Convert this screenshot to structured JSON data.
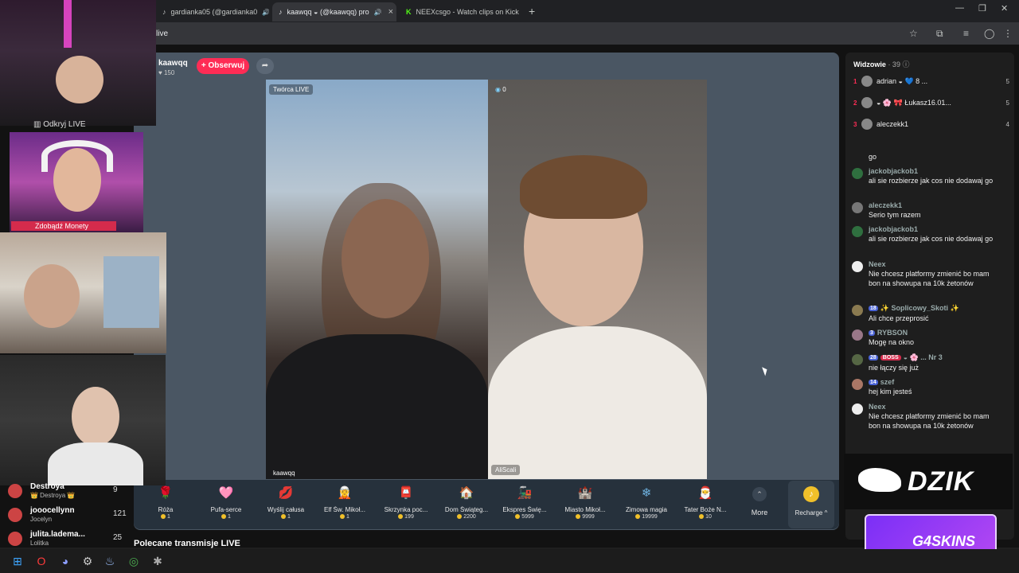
{
  "browser": {
    "tabs": [
      {
        "title": "gardianka05 (@gardianka0",
        "icon": "tiktok-icon"
      },
      {
        "title": "kaawqq ◒ (@kaawqq) pro",
        "icon": "tiktok-icon"
      },
      {
        "title": "NEEXcsgo - Watch clips on Kick",
        "icon": "kick-icon"
      }
    ],
    "url": "live"
  },
  "stream": {
    "host_name": "kaawqq",
    "host_likes": "150",
    "follow_label": "+ Obserwuj",
    "creator_badge": "Twórca LIVE",
    "guest_count": "0",
    "host_video_label": "kaawqq",
    "guest_video_label": "AliScali"
  },
  "gifts": [
    {
      "name": "Róża",
      "price": "1",
      "icon": "rose-icon",
      "color": "#e0314f",
      "glyph": "🌹"
    },
    {
      "name": "Pufa-serce",
      "price": "1",
      "icon": "heart-pouf-icon",
      "color": "#f5a9d2",
      "glyph": "🩷"
    },
    {
      "name": "Wyślij całusa",
      "price": "1",
      "icon": "kiss-icon",
      "color": "#e0314f",
      "glyph": "💋"
    },
    {
      "name": "Elf Św. Mikoł...",
      "price": "1",
      "icon": "elf-icon",
      "color": "#3aa655",
      "glyph": "🧝"
    },
    {
      "name": "Skrzynka poc...",
      "price": "199",
      "icon": "mailbox-icon",
      "color": "#d8453b",
      "glyph": "📮"
    },
    {
      "name": "Dom Świąteg...",
      "price": "2200",
      "icon": "house-icon",
      "color": "#d98b4a",
      "glyph": "🏠"
    },
    {
      "name": "Ekspres Świę...",
      "price": "5999",
      "icon": "train-icon",
      "color": "#3b8f5e",
      "glyph": "🚂"
    },
    {
      "name": "Miasto Mikoł...",
      "price": "9999",
      "icon": "castle-icon",
      "color": "#8a5ec7",
      "glyph": "🏰"
    },
    {
      "name": "Zimowa magia",
      "price": "19999",
      "icon": "winter-magic-icon",
      "color": "#6fb2e0",
      "glyph": "❄"
    },
    {
      "name": "Tater Boże N...",
      "price": "10",
      "icon": "potato-santa-icon",
      "color": "#c28a3d",
      "glyph": "🎅"
    }
  ],
  "gifts_more_label": "More",
  "recharge_label": "Recharge ^",
  "suggested_label": "Polecane transmisje LIVE",
  "chat": {
    "viewers_label": "Widzowie",
    "viewers_count": "· 39",
    "top_viewers": [
      {
        "rank": "1",
        "name": "adrian ◒ 💙 8 ...",
        "score": "5"
      },
      {
        "rank": "2",
        "name": "◒ 🌸 🎀 Łukasz16.01...",
        "score": "5"
      },
      {
        "rank": "3",
        "name": "aleczekk1",
        "score": "4"
      }
    ],
    "messages": [
      {
        "user": "",
        "text": "go",
        "lvl": "",
        "boss": ""
      },
      {
        "user": "jackobjackob1",
        "text": "ali sie rozbierze jak cos nie dodawaj go",
        "lvl": "",
        "boss": ""
      },
      {
        "user": "aleczekk1",
        "text": "Serio tym razem",
        "lvl": "",
        "boss": ""
      },
      {
        "user": "jackobjackob1",
        "text": "ali sie rozbierze jak cos nie dodawaj go",
        "lvl": "",
        "boss": ""
      },
      {
        "user": "Neex",
        "text": "Nie chcesz platformy zmienić bo mam bon na showupa na 10k żetonów",
        "lvl": "",
        "boss": ""
      },
      {
        "user": "✨ Soplicowy_Skoti ✨",
        "text": "Ali chce przeprosić",
        "lvl": "18",
        "boss": ""
      },
      {
        "user": "RYBSON",
        "text": "Mogę na okno",
        "lvl": "3",
        "boss": ""
      },
      {
        "user": "◒ 🌸 ... Nr 3",
        "text": "nie łączy się już",
        "lvl": "28",
        "boss": "BOSS"
      },
      {
        "user": "szef",
        "text": "hej kim jesteś",
        "lvl": "14",
        "boss": ""
      },
      {
        "user": "Neex",
        "text": "Nie chcesz platformy zmienić bo mam bon na showupa na 10k żetonów",
        "lvl": "",
        "boss": ""
      }
    ]
  },
  "overlay": {
    "cam1_label": "Odkryj LIVE",
    "cam2_label": "Zdobądź Monety",
    "leaderboard": [
      {
        "name": "Destroya",
        "sub": "👑 Destroya 👑",
        "num": "9"
      },
      {
        "name": "jooocellynn",
        "sub": "Jocelyn",
        "num": "121"
      },
      {
        "name": "julita.ladema...",
        "sub": "Lolitka",
        "num": "25"
      }
    ],
    "sponsor1": "DZIK",
    "sponsor2": "G4SKINS"
  }
}
